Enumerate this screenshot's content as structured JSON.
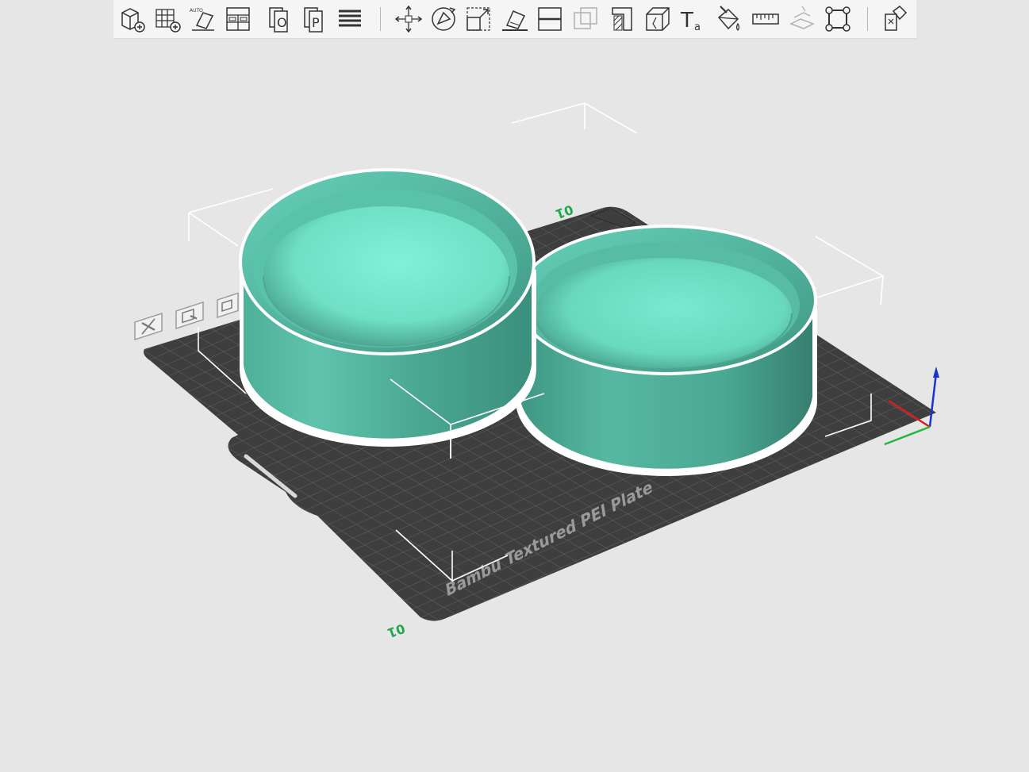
{
  "app": {
    "background_color": "#e6e6e6",
    "accent_color": "#00ae42",
    "model_color": "#5ec4ad"
  },
  "toolbar": {
    "items": [
      {
        "name": "add-object-icon",
        "enabled": true
      },
      {
        "name": "add-plate-icon",
        "enabled": true
      },
      {
        "name": "auto-orient-icon",
        "enabled": true,
        "badge": "AUTO"
      },
      {
        "name": "arrange-icon",
        "enabled": true
      },
      {
        "name": "split-to-objects-icon",
        "enabled": true,
        "glyph": "O"
      },
      {
        "name": "split-to-parts-icon",
        "enabled": true,
        "glyph": "P"
      },
      {
        "name": "variable-layer-height-icon",
        "enabled": true
      },
      {
        "name": "move-icon",
        "enabled": true
      },
      {
        "name": "rotate-icon",
        "enabled": true
      },
      {
        "name": "scale-icon",
        "enabled": true
      },
      {
        "name": "lay-on-face-icon",
        "enabled": true
      },
      {
        "name": "cut-icon",
        "enabled": true
      },
      {
        "name": "boolean-icon",
        "enabled": false
      },
      {
        "name": "support-paint-icon",
        "enabled": true
      },
      {
        "name": "seam-paint-icon",
        "enabled": true
      },
      {
        "name": "text-icon",
        "enabled": true,
        "glyph": "T",
        "sub": "a"
      },
      {
        "name": "color-paint-icon",
        "enabled": true
      },
      {
        "name": "measure-icon",
        "enabled": true
      },
      {
        "name": "assembly-icon",
        "enabled": false
      },
      {
        "name": "brim-ears-icon",
        "enabled": true
      },
      {
        "name": "assembly-view-icon",
        "enabled": true
      }
    ]
  },
  "plate": {
    "label": "Bambu Textured PEI Plate",
    "number_top": "01",
    "number_bottom": "01",
    "icons": [
      "close-plate-icon",
      "plate-settings-icon",
      "plate-lock-icon"
    ]
  },
  "objects": [
    {
      "name": "bowl-left",
      "shape": "cylindrical-cup"
    },
    {
      "name": "bowl-right",
      "shape": "cylindrical-cup"
    }
  ]
}
